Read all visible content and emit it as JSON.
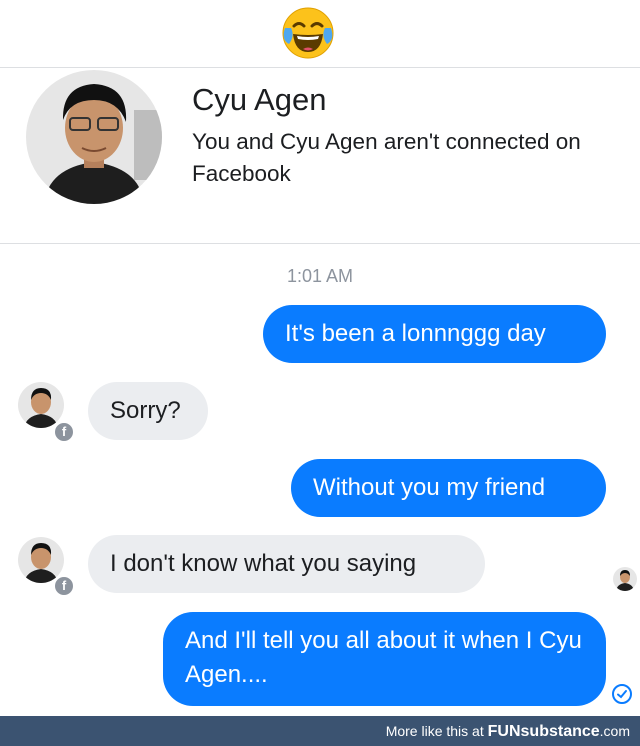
{
  "header": {
    "emoji": "crying-laughing-emoji"
  },
  "contact": {
    "name": "Cyu Agen",
    "subtitle": "You and Cyu Agen aren't connected on Facebook"
  },
  "conversation": {
    "timestamp": "1:01 AM",
    "messages": [
      {
        "direction": "outgoing",
        "text": "It's been a lonnnggg day"
      },
      {
        "direction": "incoming",
        "text": "Sorry?"
      },
      {
        "direction": "outgoing",
        "text": "Without you my friend"
      },
      {
        "direction": "incoming",
        "text": "I don't know what you saying"
      },
      {
        "direction": "outgoing",
        "text": "And I'll tell you all about it when I Cyu Agen...."
      }
    ],
    "badge_icon": "f"
  },
  "footer": {
    "prefix": "More like this at ",
    "brand_fun": "FUN",
    "brand_rest": "substance",
    "suffix": ".com"
  },
  "colors": {
    "outgoing_bubble": "#0a7cff",
    "incoming_bubble": "#ebedf0",
    "footer_bg": "#3b5371"
  }
}
